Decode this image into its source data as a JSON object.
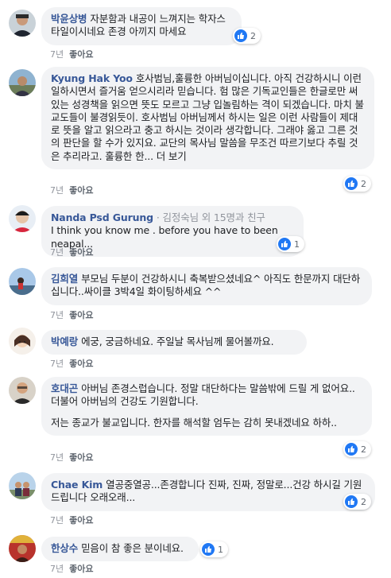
{
  "comments": [
    {
      "author": "박윤상병",
      "text": "자분함과 내공이 느껴지는 학자스타일이시네요 존경 아끼지 마세요",
      "time": "7년",
      "like": "좋아요",
      "reactions": "2"
    },
    {
      "author": "Kyung Hak Yoo",
      "text": "호사범님,훌륭한 아버님이십니다. 아직 건강하시니 이런 일하시면서 즐거움 얻으시리라 믿습니다. 험 많은 기독교인들은 한글로만 써있는 성경책을 읽으면 뜻도 모르고 그냥 입놀림하는 격이 되겠습니다. 마치 불교도들이 불경읽듯이. 호사범님 아버님께서 하시는 일은 이런 사람들이 제대로 뜻을 알고 읽으라고 충고 하시는 것이라 생각합니다. 그래야 옳고 그른 것의 판단을 할 수가 있지요. 교단의 목사님 말씀을 무조건 따르기보다 추릴 것은 추리라고. 훌륭한 한...",
      "more": "더 보기",
      "time": "7년",
      "like": "좋아요",
      "reactions": "2"
    },
    {
      "author": "Nanda Psd Gurung",
      "sub": "· 김정숙님 외 15명과 친구",
      "text": "I think you know me . before you have to been neapal...",
      "time": "7년",
      "like": "좋아요",
      "reactions": "1"
    },
    {
      "author": "김희열",
      "text": "부모님 두분이 건강하시니 축복받으셨네요^ 아직도 한문까지 대단하십니다..싸이클 3박4일 화이팅하세요 ^^",
      "time": "7년",
      "like": "좋아요",
      "reactions": ""
    },
    {
      "author": "박예랑",
      "text": "에궁, 궁금하네요. 주일날 목사님께 물어볼까요.",
      "time": "7년",
      "like": "좋아요",
      "reactions": ""
    },
    {
      "author": "호대곤",
      "text": "아버님 존경스럽습니다. 정말 대단하다는 말씀밖에 드릴 게 없어요.. 더불어 아버님의 건강도 기원합니다.",
      "text2": "저는 종교가 불교입니다. 한자를 해석할 엄두는 감히 못내겠네요 하하..",
      "time": "7년",
      "like": "좋아요",
      "reactions": "2"
    },
    {
      "author": "Chae Kim",
      "text": "열공중열공...존경합니다 진짜, 진짜, 정말로...건강 하시길 기원 드립니다 오래오래...",
      "time": "7년",
      "like": "좋아요",
      "reactions": "2"
    },
    {
      "author": "한상수",
      "text": "믿음이 참 좋은 분이네요.",
      "time": "7년",
      "like": "좋아요",
      "reactions": "1"
    }
  ]
}
